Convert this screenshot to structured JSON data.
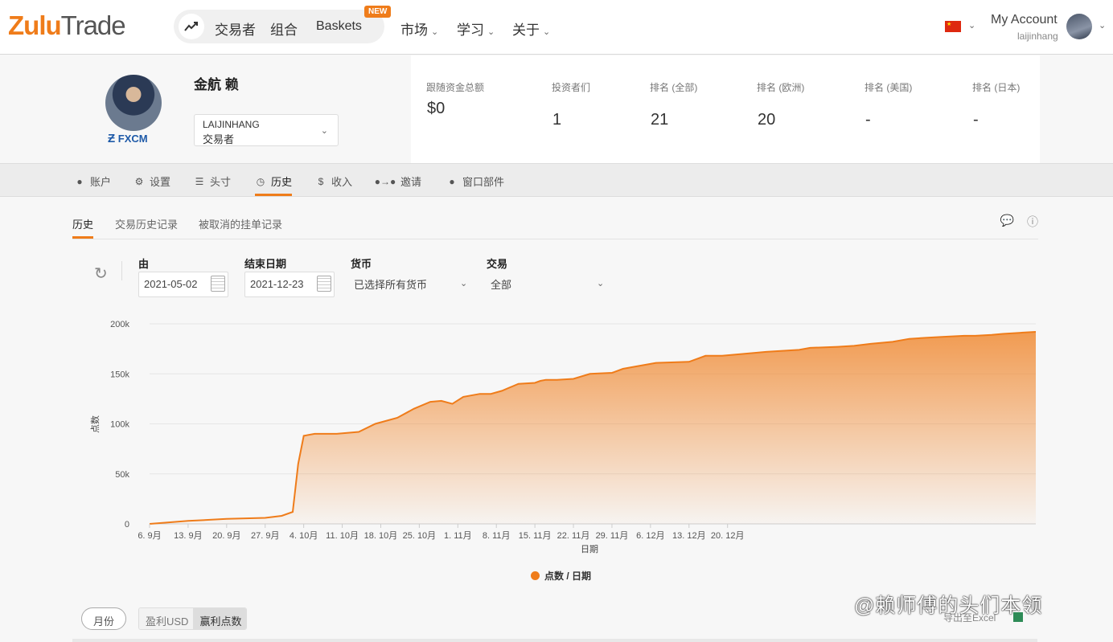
{
  "header": {
    "logo_zulu": "Zulu",
    "logo_trade": "Trade",
    "nav": [
      "交易者",
      "组合",
      "Baskets"
    ],
    "new_badge": "NEW",
    "menus": [
      "市场",
      "学习",
      "关于"
    ],
    "account_label": "My Account",
    "username": "laijinhang"
  },
  "profile": {
    "name": "金航 赖",
    "broker": "FXCM",
    "account_name": "LAIJINHANG",
    "account_role": "交易者",
    "stats": [
      {
        "label": "跟随资金总额",
        "value": "$0"
      },
      {
        "label": "投资者们",
        "value": "1"
      },
      {
        "label": "排名 (全部)",
        "value": "21"
      },
      {
        "label": "排名 (欧洲)",
        "value": "20"
      },
      {
        "label": "排名 (美国)",
        "value": "-"
      },
      {
        "label": "排名 (日本)",
        "value": "-"
      }
    ]
  },
  "tabs": [
    "账户",
    "设置",
    "头寸",
    "历史",
    "收入",
    "邀请",
    "窗口部件"
  ],
  "active_tab": "历史",
  "subtabs": [
    "历史",
    "交易历史记录",
    "被取消的挂单记录"
  ],
  "filters": {
    "from_label": "由",
    "from_value": "2021-05-02",
    "to_label": "结束日期",
    "to_value": "2021-12-23",
    "currency_label": "货币",
    "currency_value": "已选择所有货币",
    "trade_label": "交易",
    "trade_value": "全部"
  },
  "chart_data": {
    "type": "area",
    "ylabel": "点数",
    "xlabel": "日期",
    "legend": "点数 / 日期",
    "ylim": [
      0,
      200000
    ],
    "yticks": [
      "0",
      "50k",
      "100k",
      "150k",
      "200k"
    ],
    "xticks": [
      "6. 9月",
      "13. 9月",
      "20. 9月",
      "27. 9月",
      "4. 10月",
      "11. 10月",
      "18. 10月",
      "25. 10月",
      "1. 11月",
      "8. 11月",
      "15. 11月",
      "22. 11月",
      "29. 11月",
      "6. 12月",
      "13. 12月",
      "20. 12月"
    ],
    "color": "#ef7c1a",
    "x": [
      0,
      7,
      14,
      21,
      24,
      26,
      27,
      28,
      30,
      34,
      38,
      41,
      45,
      48,
      51,
      53,
      55,
      57,
      60,
      62,
      64,
      67,
      70,
      71,
      72,
      74,
      77,
      80,
      84,
      86,
      88,
      92,
      98,
      101,
      104,
      110,
      112,
      115,
      118,
      120,
      125,
      128,
      131,
      135,
      138,
      141,
      144,
      148,
      150,
      153,
      155,
      158,
      161,
      104.5
    ],
    "y": [
      0,
      3000,
      5000,
      6000,
      8000,
      12000,
      60000,
      88000,
      90000,
      90000,
      92000,
      100000,
      106000,
      115000,
      122000,
      123000,
      120000,
      127000,
      130000,
      130000,
      133000,
      140000,
      141000,
      143000,
      144000,
      144000,
      145000,
      150000,
      151000,
      155000,
      157000,
      161000,
      162000,
      168000,
      168000,
      171000,
      172000,
      173000,
      174000,
      176000,
      177000,
      178000,
      180000,
      182000,
      185000,
      186000,
      187000,
      188000,
      188000,
      189000,
      190000,
      191000,
      192000,
      192000
    ]
  },
  "bottom": {
    "month_btn": "月份",
    "toggle": [
      "盈利USD",
      "赢利点数"
    ],
    "export": "导出至Excel",
    "watermark": "@赖师傅的头们本领"
  }
}
